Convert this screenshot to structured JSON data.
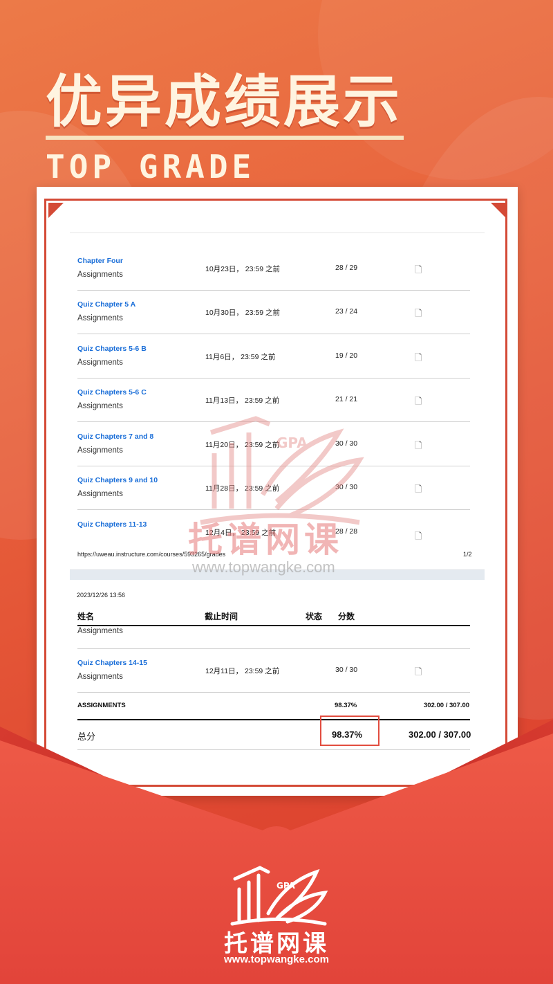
{
  "poster": {
    "headline": "优异成绩展示",
    "subheadline": "TOP GRADE"
  },
  "grades": {
    "rows": [
      {
        "name": "Chapter Four",
        "category": "Assignments",
        "due": "10月23日， 23:59 之前",
        "score": "28 / 29"
      },
      {
        "name": "Quiz Chapter 5 A",
        "category": "Assignments",
        "due": "10月30日， 23:59 之前",
        "score": "23 / 24"
      },
      {
        "name": "Quiz Chapters 5-6 B",
        "category": "Assignments",
        "due": "11月6日， 23:59 之前",
        "score": "19 / 20"
      },
      {
        "name": "Quiz Chapters 5-6 C",
        "category": "Assignments",
        "due": "11月13日， 23:59 之前",
        "score": "21 / 21"
      },
      {
        "name": "Quiz Chapters 7 and 8",
        "category": "Assignments",
        "due": "11月20日， 23:59 之前",
        "score": "30 / 30"
      },
      {
        "name": "Quiz Chapters 9 and 10",
        "category": "Assignments",
        "due": "11月28日， 23:59 之前",
        "score": "30 / 30"
      },
      {
        "name": "Quiz Chapters 11-13",
        "category": "",
        "due": "12月4日， 23:59 之前",
        "score": "28 / 28"
      }
    ],
    "page1_footer": {
      "url": "https://uweau.instructure.com/courses/593265/grades",
      "page": "1/2"
    },
    "page2": {
      "timestamp": "2023/12/26 13:56",
      "headers": {
        "name": "姓名",
        "due": "截止时间",
        "status": "状态",
        "score": "分数"
      },
      "continued_category": "Assignments",
      "rows": [
        {
          "name": "Quiz Chapters 14-15",
          "category": "Assignments",
          "due": "12月11日， 23:59 之前",
          "score": "30 / 30"
        }
      ],
      "assignments_summary": {
        "label": "ASSIGNMENTS",
        "percent": "98.37%",
        "points": "302.00 / 307.00"
      },
      "total": {
        "label": "总分",
        "percent": "98.37%",
        "points": "302.00 / 307.00"
      }
    }
  },
  "watermark": {
    "brand": "托谱网课",
    "url": "www.topwangke.com",
    "badge": "GPA"
  },
  "brand": {
    "name": "托谱网课",
    "url": "www.topwangke.com",
    "badge": "GPA"
  },
  "colors": {
    "accent": "#d44a36",
    "link": "#1a6ed8",
    "highlight": "#e24d3f"
  },
  "icons": {
    "row_action": "submission-icon"
  }
}
